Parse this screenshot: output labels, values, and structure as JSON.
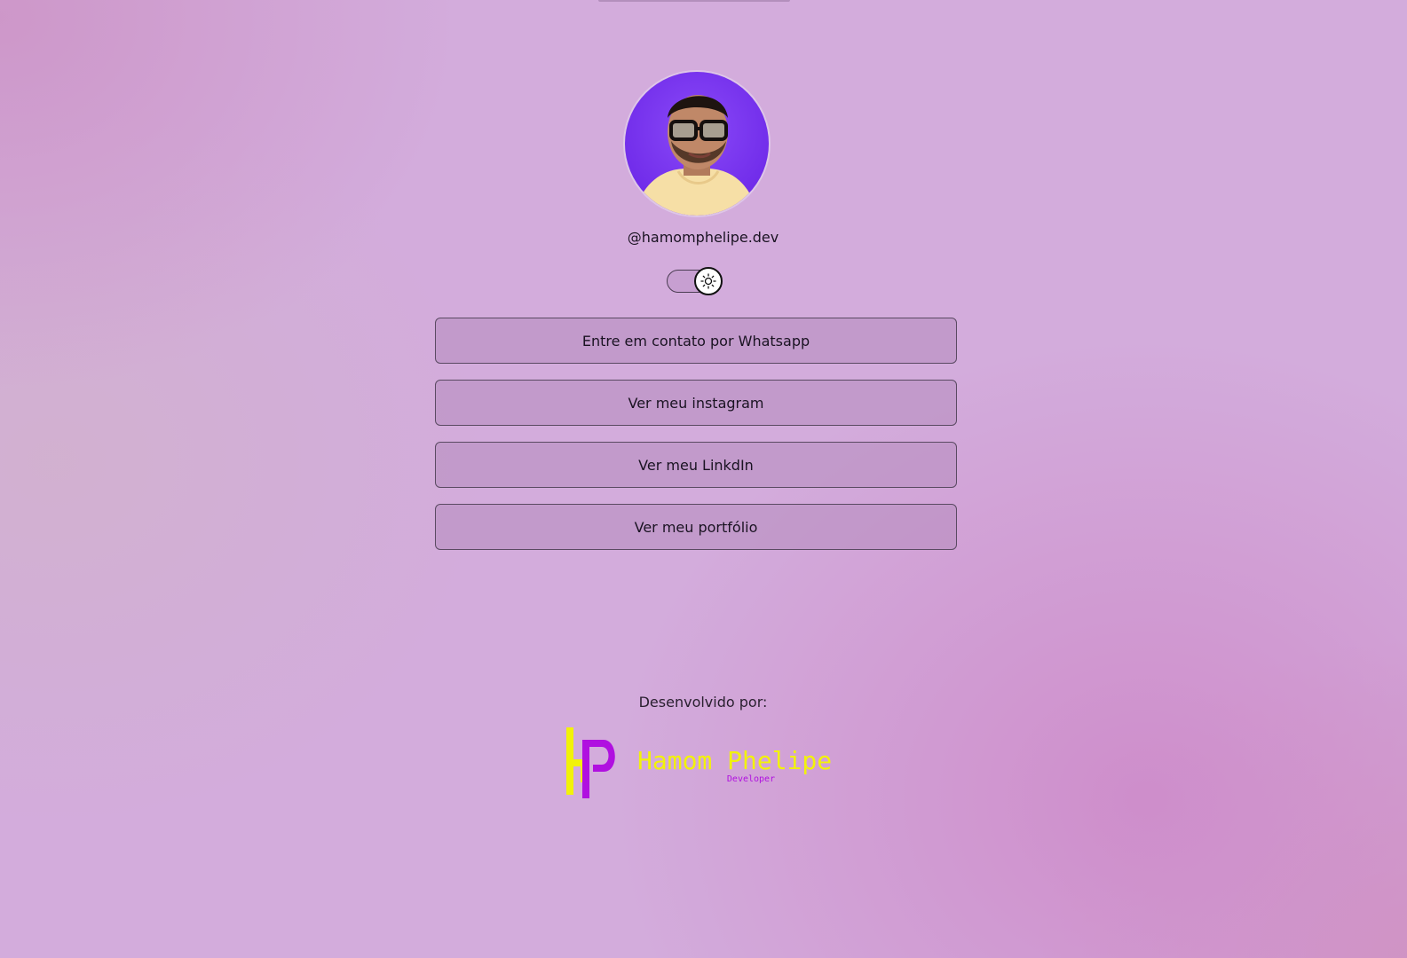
{
  "profile": {
    "username": "@hamomphelipe.dev",
    "avatar_alt": "profile photo"
  },
  "theme_toggle": {
    "state": "light",
    "icon": "sun-icon"
  },
  "links": [
    {
      "label": "Entre em contato por Whatsapp"
    },
    {
      "label": "Ver meu instagram"
    },
    {
      "label": "Ver meu LinkdIn"
    },
    {
      "label": "Ver meu portfólio"
    }
  ],
  "footer": {
    "developed_by": "Desenvolvido por:",
    "logo_name": "Hamom Phelipe",
    "logo_subtitle": "Developer"
  },
  "colors": {
    "background": "#d3acdc",
    "logo_yellow": "#f2f20a",
    "logo_purple": "#b010e0",
    "avatar_bg": "#7a34f0"
  }
}
